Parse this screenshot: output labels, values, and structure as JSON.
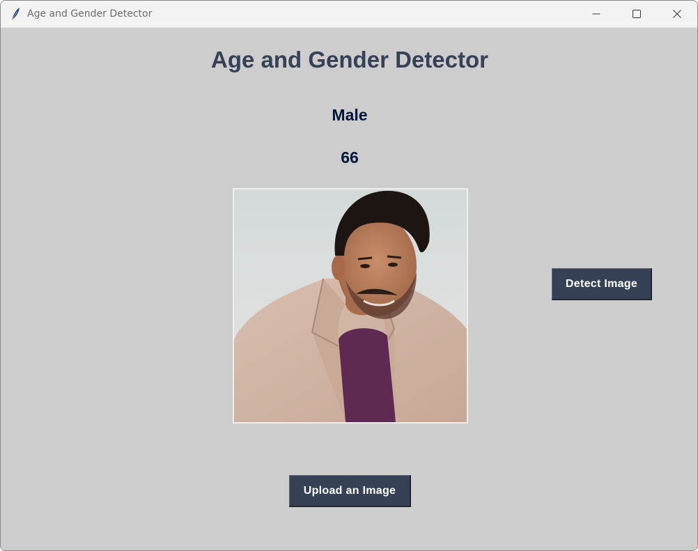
{
  "window": {
    "title": "Age and Gender Detector",
    "icon": "feather-icon",
    "controls": [
      "minimize-icon",
      "maximize-icon",
      "close-icon"
    ]
  },
  "main": {
    "heading": "Age and Gender Detector",
    "gender_result": "Male",
    "age_result": "66",
    "image": "uploaded portrait photo"
  },
  "buttons": {
    "detect_label": "Detect Image",
    "upload_label": "Upload an Image"
  },
  "colors": {
    "background": "#cdcdcd",
    "heading": "#364156",
    "result_text": "#011638",
    "button_bg": "#364156",
    "button_text": "#ffffff"
  }
}
